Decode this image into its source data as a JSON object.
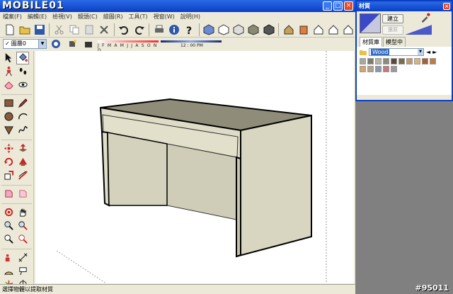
{
  "app": {
    "logo_text": "MOBILE01",
    "window_controls": {
      "minimize": "_",
      "maximize": "□",
      "close": "×"
    }
  },
  "menu": {
    "items": [
      "檔案(F)",
      "編輯(E)",
      "檢視(V)",
      "鏡頭(C)",
      "繪圖(R)",
      "工具(T)",
      "視窗(W)",
      "說明(H)"
    ]
  },
  "toolbar2": {
    "layer_name": "圖層0",
    "check": "✓",
    "months_label": "J F M A M J J A S O N D",
    "time_label": "12 : 00 PM"
  },
  "statusbar": {
    "text": "選擇物體以提取材質"
  },
  "panel": {
    "title": "材質",
    "create_button": "建立",
    "reset_button": "還原",
    "tabs": [
      "材質庫",
      "模型中"
    ],
    "library": "Wood",
    "nav_back": "◄",
    "nav_forward": "►"
  },
  "watermark": "#95011",
  "colors": {
    "title_blue": "#0a3fc4",
    "desk_top": "#8f8d7a",
    "desk_side": "#d8d6c0"
  },
  "swatches": [
    [
      "#a9a69a",
      "#7d7a6e",
      "#b7b3a6",
      "#8c8a7c",
      "#5c4a36",
      "#7b6a4c",
      "#c39a62",
      "#d9b47c",
      "#a9602e",
      "#c07a44"
    ],
    [
      "#d4a46a",
      "#b5a08a",
      "#8a98a8",
      "#c17a80",
      "#9a9a9a"
    ]
  ]
}
